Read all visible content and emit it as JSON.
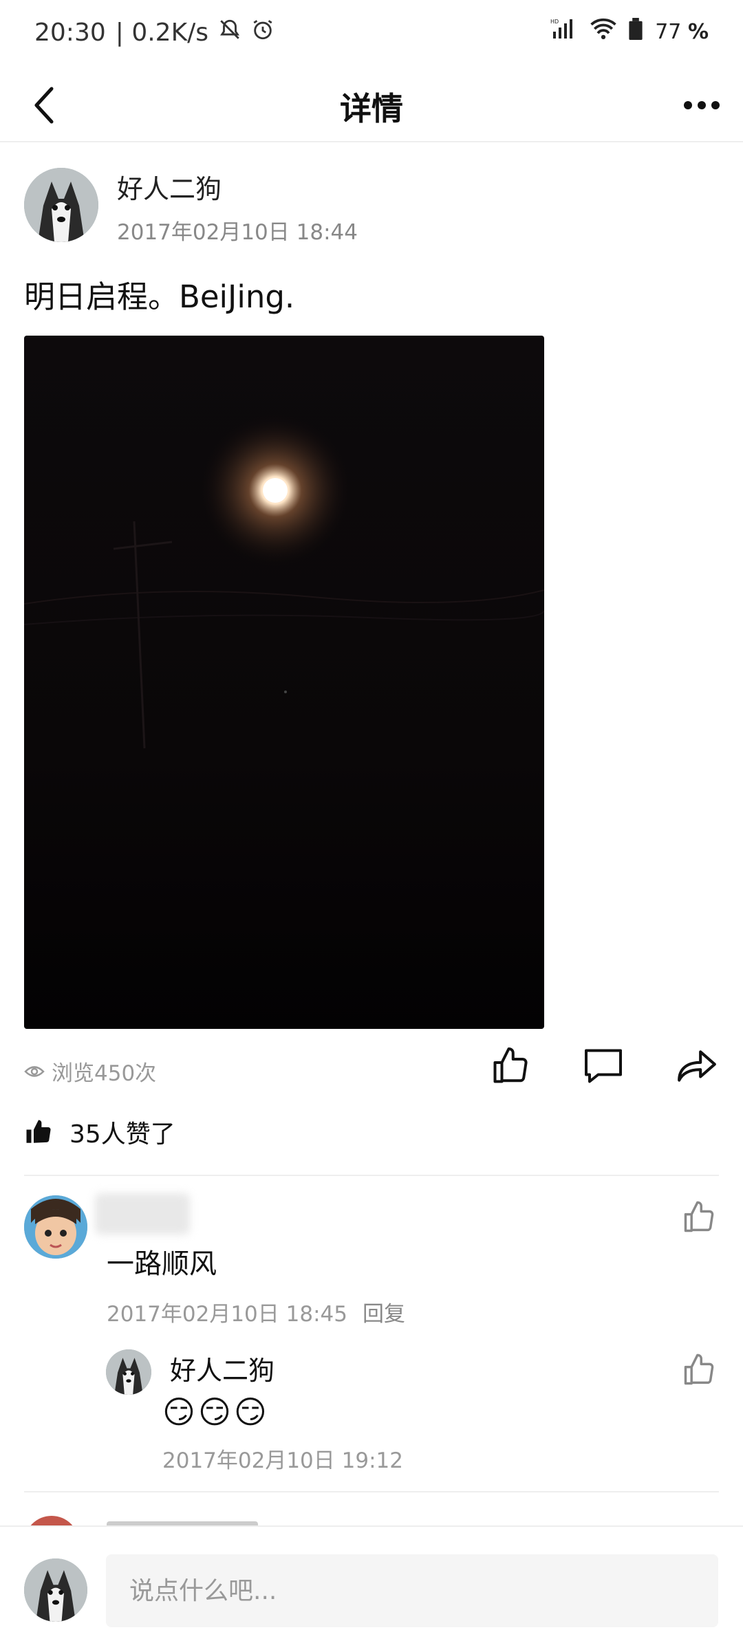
{
  "status_bar": {
    "time": "20:30",
    "speed": "| 0.2K/s",
    "battery": "77",
    "battery_unit": "%"
  },
  "header": {
    "title": "详情"
  },
  "post": {
    "author": "好人二狗",
    "time": "2017年02月10日 18:44",
    "text": "明日启程。BeiJing.",
    "views": "浏览450次",
    "likes": "35人赞了"
  },
  "comments": [
    {
      "text": "一路顺风",
      "time": "2017年02月10日 18:45",
      "reply_label": "回复",
      "replies": [
        {
          "author": "好人二狗",
          "text": "😏😏😏",
          "time": "2017年02月10日 19:12"
        }
      ]
    }
  ],
  "bottom": {
    "placeholder": "说点什么吧..."
  }
}
